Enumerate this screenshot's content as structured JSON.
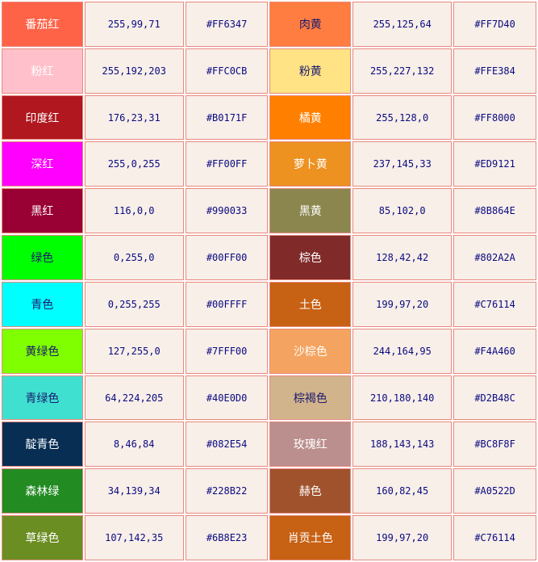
{
  "table": {
    "rows": [
      {
        "left": {
          "name": "番茄红",
          "rgb": "255,99,71",
          "hex": "#FF6347",
          "color": "#FF6347",
          "text_color": "#ffffff"
        },
        "right": {
          "name": "肉黄",
          "rgb": "255,125,64",
          "hex": "#FF7D40",
          "color": "#FF7D40",
          "text_color": "#1a1a6e"
        }
      },
      {
        "left": {
          "name": "粉红",
          "rgb": "255,192,203",
          "hex": "#FFC0CB",
          "color": "#FFC0CB",
          "text_color": "#ffffff"
        },
        "right": {
          "name": "粉黄",
          "rgb": "255,227,132",
          "hex": "#FFE384",
          "color": "#FFE384",
          "text_color": "#1a1a6e"
        }
      },
      {
        "left": {
          "name": "印度红",
          "rgb": "176,23,31",
          "hex": "#B0171F",
          "color": "#B0171F",
          "text_color": "#ffffff"
        },
        "right": {
          "name": "橘黄",
          "rgb": "255,128,0",
          "hex": "#FF8000",
          "color": "#FF8000",
          "text_color": "#ffffff"
        }
      },
      {
        "left": {
          "name": "深红",
          "rgb": "255,0,255",
          "hex": "#FF00FF",
          "color": "#FF00FF",
          "text_color": "#ffffff"
        },
        "right": {
          "name": "萝卜黄",
          "rgb": "237,145,33",
          "hex": "#ED9121",
          "color": "#ED9121",
          "text_color": "#ffffff"
        }
      },
      {
        "left": {
          "name": "黑红",
          "rgb": "116,0,0",
          "hex": "#990033",
          "color": "#990033",
          "text_color": "#ffffff"
        },
        "right": {
          "name": "黑黄",
          "rgb": "85,102,0",
          "hex": "#8B864E",
          "color": "#8B864E",
          "text_color": "#ffffff"
        }
      },
      {
        "left": {
          "name": "绿色",
          "rgb": "0,255,0",
          "hex": "#00FF00",
          "color": "#00FF00",
          "text_color": "#1a1a6e"
        },
        "right": {
          "name": "棕色",
          "rgb": "128,42,42",
          "hex": "#802A2A",
          "color": "#802A2A",
          "text_color": "#ffffff"
        }
      },
      {
        "left": {
          "name": "青色",
          "rgb": "0,255,255",
          "hex": "#00FFFF",
          "color": "#00FFFF",
          "text_color": "#1a1a6e"
        },
        "right": {
          "name": "土色",
          "rgb": "199,97,20",
          "hex": "#C76114",
          "color": "#C76114",
          "text_color": "#ffffff"
        }
      },
      {
        "left": {
          "name": "黄绿色",
          "rgb": "127,255,0",
          "hex": "#7FFF00",
          "color": "#7FFF00",
          "text_color": "#1a1a6e"
        },
        "right": {
          "name": "沙棕色",
          "rgb": "244,164,95",
          "hex": "#F4A460",
          "color": "#F4A460",
          "text_color": "#ffffff"
        }
      },
      {
        "left": {
          "name": "青绿色",
          "rgb": "64,224,205",
          "hex": "#40E0D0",
          "color": "#40E0D0",
          "text_color": "#1a1a6e"
        },
        "right": {
          "name": "棕褐色",
          "rgb": "210,180,140",
          "hex": "#D2B48C",
          "color": "#D2B48C",
          "text_color": "#1a1a6e"
        }
      },
      {
        "left": {
          "name": "靛青色",
          "rgb": "8,46,84",
          "hex": "#082E54",
          "color": "#082E54",
          "text_color": "#ffffff"
        },
        "right": {
          "name": "玫瑰红",
          "rgb": "188,143,143",
          "hex": "#BC8F8F",
          "color": "#BC8F8F",
          "text_color": "#ffffff"
        }
      },
      {
        "left": {
          "name": "森林绿",
          "rgb": "34,139,34",
          "hex": "#228B22",
          "color": "#228B22",
          "text_color": "#ffffff"
        },
        "right": {
          "name": "赫色",
          "rgb": "160,82,45",
          "hex": "#A0522D",
          "color": "#A0522D",
          "text_color": "#ffffff"
        }
      },
      {
        "left": {
          "name": "草绿色",
          "rgb": "107,142,35",
          "hex": "#6B8E23",
          "color": "#6B8E23",
          "text_color": "#ffffff"
        },
        "right": {
          "name": "肖贡土色",
          "rgb": "199,97,20",
          "hex": "#C76114",
          "color": "#C76114",
          "text_color": "#ffffff"
        }
      }
    ]
  }
}
